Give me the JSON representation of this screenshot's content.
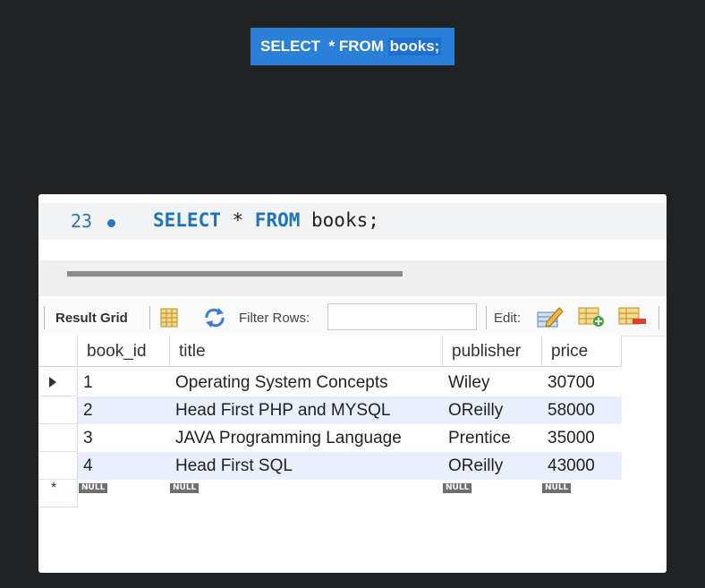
{
  "top_label": {
    "pre": "SELECT  * FROM ",
    "highlight": "books;"
  },
  "editor": {
    "line_number": "23",
    "kw_select": "SELECT",
    "star": " * ",
    "kw_from": "FROM",
    "rest": " books;"
  },
  "toolbar": {
    "result_grid": "Result Grid",
    "filter_rows": "Filter Rows:",
    "filter_value": "",
    "edit": "Edit:"
  },
  "grid": {
    "columns": [
      "book_id",
      "title",
      "publisher",
      "price"
    ],
    "rows": [
      [
        "1",
        "Operating System Concepts",
        "Wiley",
        "30700"
      ],
      [
        "2",
        "Head First PHP and MYSQL",
        "OReilly",
        "58000"
      ],
      [
        "3",
        "JAVA Programming Language",
        "Prentice",
        "35000"
      ],
      [
        "4",
        "Head First SQL",
        "OReilly",
        "43000"
      ]
    ],
    "null_text": "NULL"
  },
  "colors": {
    "accent": "#2a7fd6",
    "keyword": "#1f73b7",
    "alt_row": "#e9f0fb"
  },
  "icons": [
    "result-grid-icon",
    "refresh-icon",
    "edit-row-icon",
    "add-row-icon",
    "delete-row-icon"
  ]
}
